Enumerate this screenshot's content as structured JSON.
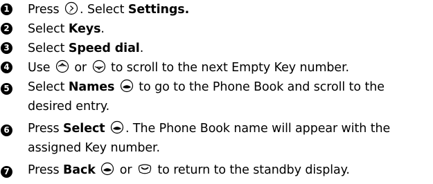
{
  "steps": [
    {
      "number": "1",
      "parts": [
        {
          "t": "Press "
        },
        {
          "icon": "menu-key-icon"
        },
        {
          "t": ". Select "
        },
        {
          "b": "Settings."
        }
      ]
    },
    {
      "number": "2",
      "parts": [
        {
          "t": "Select "
        },
        {
          "b": "Keys"
        },
        {
          "t": "."
        }
      ]
    },
    {
      "number": "3",
      "parts": [
        {
          "t": "Select "
        },
        {
          "b": "Speed dial"
        },
        {
          "t": "."
        }
      ]
    },
    {
      "number": "4",
      "parts": [
        {
          "t": "Use "
        },
        {
          "icon": "scroll-up-key-icon"
        },
        {
          "t": " or "
        },
        {
          "icon": "scroll-down-key-icon"
        },
        {
          "t": " to scroll to the next Empty Key number."
        }
      ]
    },
    {
      "number": "5",
      "parts": [
        {
          "t": "Select "
        },
        {
          "b": "Names"
        },
        {
          "t": " "
        },
        {
          "icon": "left-soft-key-icon"
        },
        {
          "t": " to go to the Phone Book and scroll to the desired entry."
        }
      ]
    },
    {
      "number": "6",
      "parts": [
        {
          "t": "Press "
        },
        {
          "b": "Select"
        },
        {
          "t": " "
        },
        {
          "icon": "left-soft-key-icon"
        },
        {
          "t": ". The Phone Book name will appear with the assigned Key number."
        }
      ]
    },
    {
      "number": "7",
      "parts": [
        {
          "t": "Press "
        },
        {
          "b": "Back"
        },
        {
          "t": " "
        },
        {
          "icon": "right-soft-key-icon"
        },
        {
          "t": " or "
        },
        {
          "icon": "end-key-icon"
        },
        {
          "t": " to return to the standby display."
        }
      ]
    }
  ]
}
